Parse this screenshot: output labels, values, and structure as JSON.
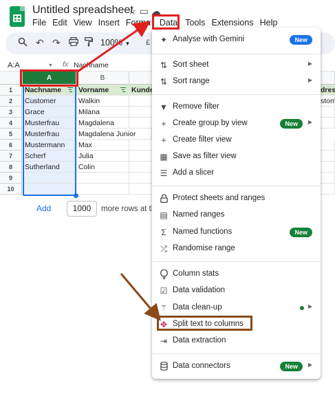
{
  "app": {
    "title": "Untitled spreadsheet",
    "menus": [
      "File",
      "Edit",
      "View",
      "Insert",
      "Format",
      "Data",
      "Tools",
      "Extensions",
      "Help"
    ],
    "active_menu": "Data",
    "zoom": "100%",
    "currency_hint": "£"
  },
  "formula_bar": {
    "name_box": "A:A",
    "fx_label": "fx",
    "value": "Nachname"
  },
  "grid": {
    "columns": [
      "A",
      "B"
    ],
    "row_numbers": [
      "1",
      "2",
      "3",
      "4",
      "5",
      "6",
      "7",
      "8",
      "9",
      "10"
    ],
    "header_row": [
      "Nachname",
      "Vorname",
      "Kunde",
      "dres",
      "stome"
    ],
    "rows": [
      [
        "Customer",
        "Walkin"
      ],
      [
        "Grace",
        "Milana"
      ],
      [
        "Musterfrau",
        "Magdalena"
      ],
      [
        "Musterfrau",
        "Magdalena Junior"
      ],
      [
        "Mustermann",
        "Max"
      ],
      [
        "Scherf",
        "Julia"
      ],
      [
        "Sutherland",
        "Colin"
      ],
      [
        "",
        ""
      ],
      [
        "",
        ""
      ]
    ]
  },
  "add_rows": {
    "link": "Add",
    "count": "1000",
    "suffix": "more rows at the bottom"
  },
  "data_menu": {
    "items": [
      {
        "label": "Analyse with Gemini",
        "icon": "sparkle-icon",
        "badge": "New"
      },
      {
        "label": "Sort sheet",
        "icon": "sort-icon",
        "submenu": true
      },
      {
        "label": "Sort range",
        "icon": "sort-icon",
        "submenu": true
      },
      {
        "label": "Remove filter",
        "icon": "filter-icon"
      },
      {
        "label": "Create group by view",
        "icon": "plus-icon",
        "badge": "New",
        "submenu": true
      },
      {
        "label": "Create filter view",
        "icon": "plus-icon"
      },
      {
        "label": "Save as filter view",
        "icon": "table-save-icon"
      },
      {
        "label": "Add a slicer",
        "icon": "slicer-icon"
      },
      {
        "label": "Protect sheets and ranges",
        "icon": "lock-icon"
      },
      {
        "label": "Named ranges",
        "icon": "named-range-icon"
      },
      {
        "label": "Named functions",
        "icon": "sigma-icon",
        "badge": "New"
      },
      {
        "label": "Randomise range",
        "icon": "shuffle-icon"
      },
      {
        "label": "Column stats",
        "icon": "bulb-icon"
      },
      {
        "label": "Data validation",
        "icon": "validation-icon"
      },
      {
        "label": "Data clean-up",
        "icon": "magic-wand-icon",
        "submenu": true
      },
      {
        "label": "Split text to columns",
        "icon": "split-icon"
      },
      {
        "label": "Data extraction",
        "icon": "extract-icon"
      },
      {
        "label": "Data connectors",
        "icon": "database-icon",
        "badge": "New",
        "submenu": true
      }
    ]
  },
  "colors": {
    "annotation_red": "#e02020",
    "annotation_brown": "#8a4a1a",
    "selected_column": "#207a3c",
    "header_row_fill": "#d9ead3",
    "badge_blue": "#1a73e8",
    "badge_green": "#188038"
  }
}
